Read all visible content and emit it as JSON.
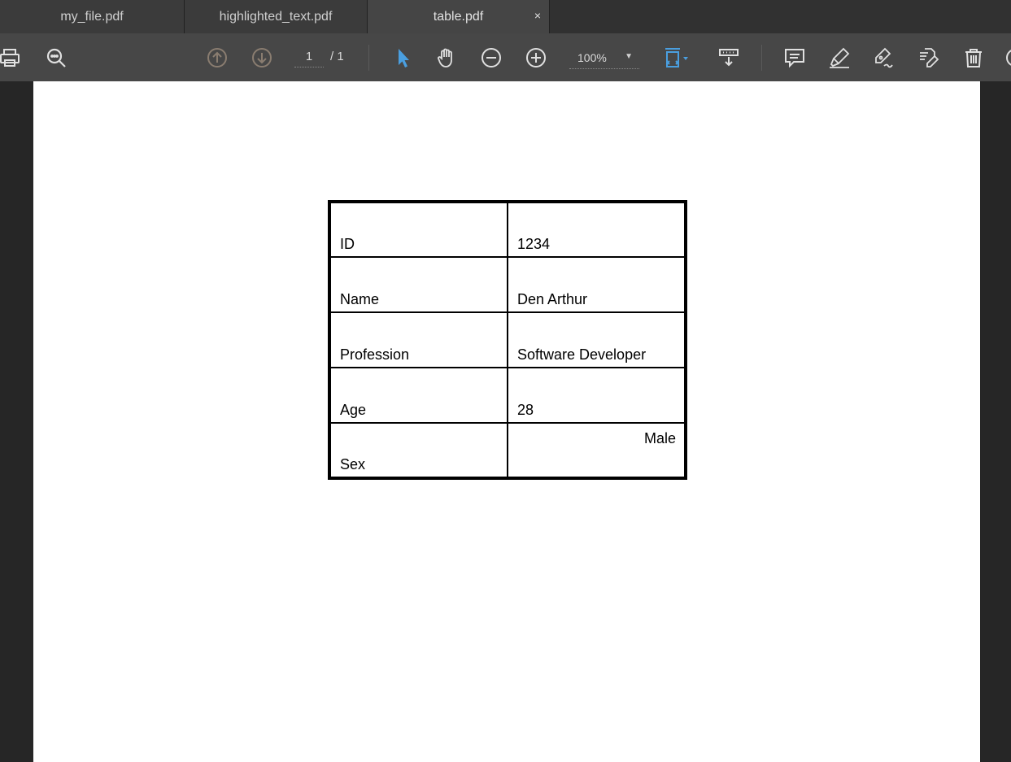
{
  "tabs": [
    {
      "label": "my_file.pdf"
    },
    {
      "label": "highlighted_text.pdf"
    },
    {
      "label": "table.pdf",
      "close": "×"
    }
  ],
  "toolbar": {
    "page_current": "1",
    "page_total": "/ 1",
    "zoom": "100%",
    "icons": [
      "print-icon",
      "search-icon",
      "prev-page-icon",
      "next-page-icon",
      "select-cursor-icon",
      "hand-tool-icon",
      "zoom-out-icon",
      "zoom-in-icon",
      "fit-page-icon",
      "download-icon",
      "comment-icon",
      "highlight-icon",
      "sign-icon",
      "edit-icon",
      "delete-icon"
    ],
    "accent": "#4a9fe0"
  },
  "document": {
    "rows": [
      {
        "label": "ID",
        "value": "1234"
      },
      {
        "label": "Name",
        "value": "Den Arthur"
      },
      {
        "label": "Profession",
        "value": "Software Developer"
      },
      {
        "label": "Age",
        "value": "28"
      },
      {
        "label": "Sex",
        "value": "Male"
      }
    ]
  }
}
